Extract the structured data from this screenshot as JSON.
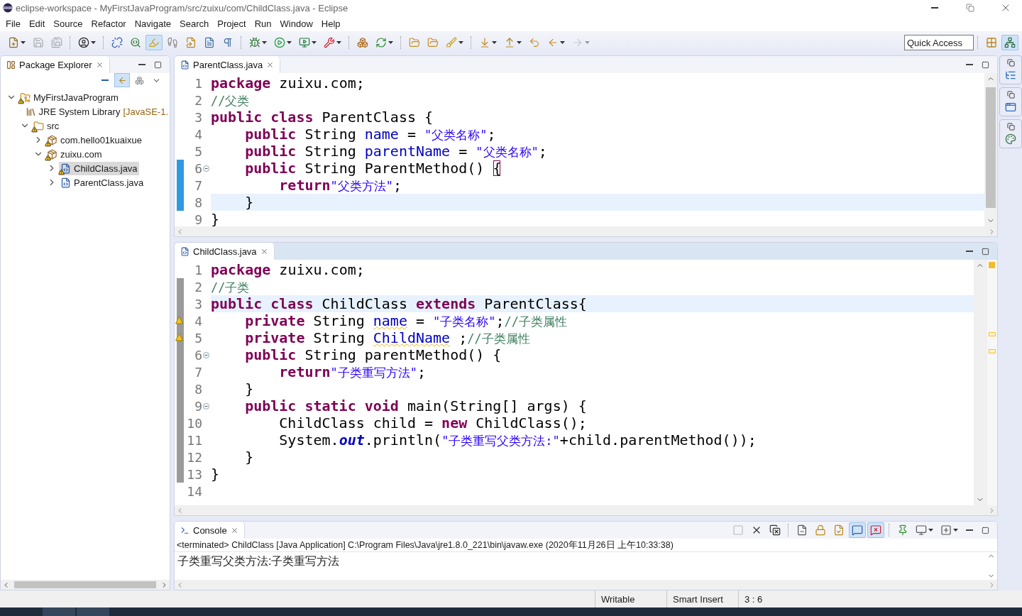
{
  "window": {
    "title": "eclipse-workspace - MyFirstJavaProgram/src/zuixu/com/ChildClass.java - Eclipse"
  },
  "menu": [
    "File",
    "Edit",
    "Source",
    "Refactor",
    "Navigate",
    "Search",
    "Project",
    "Run",
    "Window",
    "Help"
  ],
  "toolbar": {
    "buttons": [
      {
        "pressed": false,
        "dropdown": true,
        "disabled": false
      },
      {
        "pressed": false,
        "dropdown": false,
        "disabled": true
      },
      {
        "pressed": false,
        "dropdown": false,
        "disabled": true
      },
      {
        "pressed": false,
        "dropdown": true,
        "disabled": false
      },
      {
        "pressed": false,
        "dropdown": false,
        "disabled": false
      },
      {
        "pressed": false,
        "dropdown": false,
        "disabled": false
      },
      {
        "pressed": true,
        "dropdown": false,
        "disabled": false
      },
      {
        "pressed": false,
        "dropdown": false,
        "disabled": false
      },
      {
        "pressed": false,
        "dropdown": false,
        "disabled": false
      },
      {
        "pressed": false,
        "dropdown": false,
        "disabled": false
      },
      {
        "pressed": false,
        "dropdown": false,
        "disabled": false
      },
      {
        "pressed": false,
        "dropdown": true,
        "disabled": false
      },
      {
        "pressed": false,
        "dropdown": true,
        "disabled": false
      },
      {
        "pressed": false,
        "dropdown": true,
        "disabled": false
      },
      {
        "pressed": false,
        "dropdown": true,
        "disabled": false
      },
      {
        "pressed": false,
        "dropdown": false,
        "disabled": false
      },
      {
        "pressed": false,
        "dropdown": true,
        "disabled": false
      },
      {
        "pressed": false,
        "dropdown": false,
        "disabled": false
      },
      {
        "pressed": false,
        "dropdown": false,
        "disabled": false
      },
      {
        "pressed": false,
        "dropdown": true,
        "disabled": false
      },
      {
        "pressed": false,
        "dropdown": true,
        "disabled": false
      },
      {
        "pressed": false,
        "dropdown": true,
        "disabled": false
      },
      {
        "pressed": false,
        "dropdown": false,
        "disabled": false
      },
      {
        "pressed": false,
        "dropdown": true,
        "disabled": false
      },
      {
        "pressed": false,
        "dropdown": true,
        "disabled": true
      }
    ],
    "quick_access": {
      "placeholder": "Quick Access"
    },
    "perspectives": [
      {
        "selected": false
      },
      {
        "selected": true
      }
    ]
  },
  "package_explorer": {
    "title": "Package Explorer",
    "tree": [
      {
        "kind": "project",
        "label": "MyFirstJavaProgram",
        "expanded": true,
        "selected": false,
        "warning": true,
        "children": [
          {
            "kind": "library",
            "label": "JRE System Library",
            "decoration": "[JavaSE-1.",
            "expanded": false,
            "selected": false,
            "warning": false
          },
          {
            "kind": "folder",
            "label": "src",
            "expanded": true,
            "selected": false,
            "warning": true,
            "children": [
              {
                "kind": "package",
                "label": "com.hello01kuaixue",
                "expanded": false,
                "selected": false,
                "warning": true
              },
              {
                "kind": "package",
                "label": "zuixu.com",
                "expanded": true,
                "selected": false,
                "warning": true,
                "children": [
                  {
                    "kind": "file",
                    "label": "ChildClass.java",
                    "expanded": false,
                    "selected": true,
                    "warning": true
                  },
                  {
                    "kind": "file",
                    "label": "ParentClass.java",
                    "expanded": false,
                    "selected": false,
                    "warning": false
                  }
                ]
              }
            ]
          }
        ]
      }
    ]
  },
  "editors": [
    {
      "tab": "ParentClass.java",
      "active": false,
      "lines": [
        {
          "no": "1",
          "current": false,
          "foldable": false,
          "warning": false,
          "marked": false,
          "tokens": [
            {
              "kind": "kw",
              "text": "package"
            },
            {
              "kind": "plain",
              "text": " zuixu.com;"
            }
          ]
        },
        {
          "no": "2",
          "current": false,
          "foldable": false,
          "warning": false,
          "marked": false,
          "tokens": [
            {
              "kind": "comment",
              "text": "//父类"
            }
          ]
        },
        {
          "no": "3",
          "current": false,
          "foldable": false,
          "warning": false,
          "marked": false,
          "tokens": [
            {
              "kind": "kw",
              "text": "public class"
            },
            {
              "kind": "plain",
              "text": " ParentClass {"
            }
          ]
        },
        {
          "no": "4",
          "current": false,
          "foldable": false,
          "warning": false,
          "marked": false,
          "tokens": [
            {
              "kind": "kw",
              "text": "    public"
            },
            {
              "kind": "plain",
              "text": " String "
            },
            {
              "kind": "field",
              "text": "name"
            },
            {
              "kind": "plain",
              "text": " = "
            },
            {
              "kind": "string",
              "text": "\"父类名称\""
            },
            {
              "kind": "plain",
              "text": ";"
            }
          ]
        },
        {
          "no": "5",
          "current": false,
          "foldable": false,
          "warning": false,
          "marked": false,
          "tokens": [
            {
              "kind": "kw",
              "text": "    public"
            },
            {
              "kind": "plain",
              "text": " String "
            },
            {
              "kind": "field",
              "text": "parentName"
            },
            {
              "kind": "plain",
              "text": " = "
            },
            {
              "kind": "string",
              "text": "\"父类名称\""
            },
            {
              "kind": "plain",
              "text": ";"
            }
          ]
        },
        {
          "no": "6",
          "current": false,
          "foldable": true,
          "warning": false,
          "marked": true,
          "tokens": [
            {
              "kind": "kw",
              "text": "    public"
            },
            {
              "kind": "plain",
              "text": " String ParentMethod() "
            },
            {
              "kind": "bracket",
              "text": "{"
            }
          ]
        },
        {
          "no": "7",
          "current": false,
          "foldable": false,
          "warning": false,
          "marked": true,
          "tokens": [
            {
              "kind": "kw",
              "text": "        return"
            },
            {
              "kind": "string",
              "text": "\"父类方法\""
            },
            {
              "kind": "plain",
              "text": ";"
            }
          ]
        },
        {
          "no": "8",
          "current": true,
          "foldable": false,
          "warning": false,
          "marked": true,
          "tokens": [
            {
              "kind": "plain",
              "text": "    }"
            }
          ]
        },
        {
          "no": "9",
          "current": false,
          "foldable": false,
          "warning": false,
          "marked": false,
          "tokens": [
            {
              "kind": "plain",
              "text": "}"
            }
          ]
        }
      ]
    },
    {
      "tab": "ChildClass.java",
      "active": true,
      "lines": [
        {
          "no": "1",
          "current": false,
          "foldable": false,
          "warning": false,
          "marked": false,
          "tokens": [
            {
              "kind": "kw",
              "text": "package"
            },
            {
              "kind": "plain",
              "text": " zuixu.com;"
            }
          ]
        },
        {
          "no": "2",
          "current": false,
          "foldable": false,
          "warning": false,
          "marked": true,
          "tokens": [
            {
              "kind": "comment",
              "text": "//子类"
            }
          ]
        },
        {
          "no": "3",
          "current": true,
          "foldable": false,
          "warning": false,
          "marked": true,
          "tokens": [
            {
              "kind": "kw",
              "text": "public class"
            },
            {
              "kind": "plain",
              "text": " ChildClass "
            },
            {
              "kind": "kw",
              "text": "extends"
            },
            {
              "kind": "plain",
              "text": " ParentClass{"
            }
          ]
        },
        {
          "no": "4",
          "current": false,
          "foldable": false,
          "warning": true,
          "marked": true,
          "tokens": [
            {
              "kind": "kw",
              "text": "    private"
            },
            {
              "kind": "plain",
              "text": " String "
            },
            {
              "kind": "field_warn",
              "text": "name"
            },
            {
              "kind": "plain",
              "text": " = "
            },
            {
              "kind": "string",
              "text": "\"子类名称\""
            },
            {
              "kind": "plain",
              "text": ";"
            },
            {
              "kind": "comment",
              "text": "//子类属性"
            }
          ]
        },
        {
          "no": "5",
          "current": false,
          "foldable": false,
          "warning": true,
          "marked": true,
          "tokens": [
            {
              "kind": "kw",
              "text": "    private"
            },
            {
              "kind": "plain",
              "text": " String "
            },
            {
              "kind": "field_warn",
              "text": "ChildName"
            },
            {
              "kind": "plain",
              "text": " ;"
            },
            {
              "kind": "comment",
              "text": "//子类属性"
            }
          ]
        },
        {
          "no": "6",
          "current": false,
          "foldable": true,
          "warning": false,
          "marked": true,
          "tokens": [
            {
              "kind": "kw",
              "text": "    public"
            },
            {
              "kind": "plain",
              "text": " String parentMethod() {"
            }
          ]
        },
        {
          "no": "7",
          "current": false,
          "foldable": false,
          "warning": false,
          "marked": true,
          "tokens": [
            {
              "kind": "kw",
              "text": "        return"
            },
            {
              "kind": "string",
              "text": "\"子类重写方法\""
            },
            {
              "kind": "plain",
              "text": ";"
            }
          ]
        },
        {
          "no": "8",
          "current": false,
          "foldable": false,
          "warning": false,
          "marked": true,
          "tokens": [
            {
              "kind": "plain",
              "text": "    }"
            }
          ]
        },
        {
          "no": "9",
          "current": false,
          "foldable": true,
          "warning": false,
          "marked": true,
          "tokens": [
            {
              "kind": "kw",
              "text": "    public static void"
            },
            {
              "kind": "plain",
              "text": " main(String[] args) {"
            }
          ]
        },
        {
          "no": "10",
          "current": false,
          "foldable": false,
          "warning": false,
          "marked": true,
          "tokens": [
            {
              "kind": "plain",
              "text": "        ChildClass child = "
            },
            {
              "kind": "kw",
              "text": "new"
            },
            {
              "kind": "plain",
              "text": " ChildClass();"
            }
          ]
        },
        {
          "no": "11",
          "current": false,
          "foldable": false,
          "warning": false,
          "marked": true,
          "tokens": [
            {
              "kind": "plain",
              "text": "        System."
            },
            {
              "kind": "static",
              "text": "out"
            },
            {
              "kind": "plain",
              "text": ".println("
            },
            {
              "kind": "string",
              "text": "\"子类重写父类方法:\""
            },
            {
              "kind": "plain",
              "text": "+child.parentMethod());"
            }
          ]
        },
        {
          "no": "12",
          "current": false,
          "foldable": false,
          "warning": false,
          "marked": true,
          "tokens": [
            {
              "kind": "plain",
              "text": "    }"
            }
          ]
        },
        {
          "no": "13",
          "current": false,
          "foldable": false,
          "warning": false,
          "marked": true,
          "tokens": [
            {
              "kind": "plain",
              "text": "}"
            }
          ]
        },
        {
          "no": "14",
          "current": false,
          "foldable": false,
          "warning": false,
          "marked": false
        }
      ]
    }
  ],
  "console": {
    "title": "Console",
    "toolbar": [
      {
        "pressed": false,
        "dropdown": false,
        "disabled": true
      },
      {
        "pressed": false,
        "dropdown": false,
        "disabled": false
      },
      {
        "pressed": false,
        "dropdown": false,
        "disabled": false
      },
      {
        "pressed": false,
        "dropdown": false,
        "disabled": false
      },
      {
        "pressed": false,
        "dropdown": false,
        "disabled": false
      },
      {
        "pressed": false,
        "dropdown": false,
        "disabled": false
      },
      {
        "pressed": true,
        "dropdown": false,
        "disabled": false
      },
      {
        "pressed": true,
        "dropdown": false,
        "disabled": false
      },
      {
        "pressed": false,
        "dropdown": false,
        "disabled": false
      },
      {
        "pressed": false,
        "dropdown": true,
        "disabled": false
      },
      {
        "pressed": false,
        "dropdown": true,
        "disabled": false
      }
    ],
    "description": "<terminated> ChildClass [Java Application] C:\\Program Files\\Java\\jre1.8.0_221\\bin\\javaw.exe (2020年11月26日 上午10:33:38)",
    "output": "子类重写父类方法:子类重写方法"
  },
  "status_bar": [
    "Writable",
    "Smart Insert",
    "3 : 6"
  ]
}
